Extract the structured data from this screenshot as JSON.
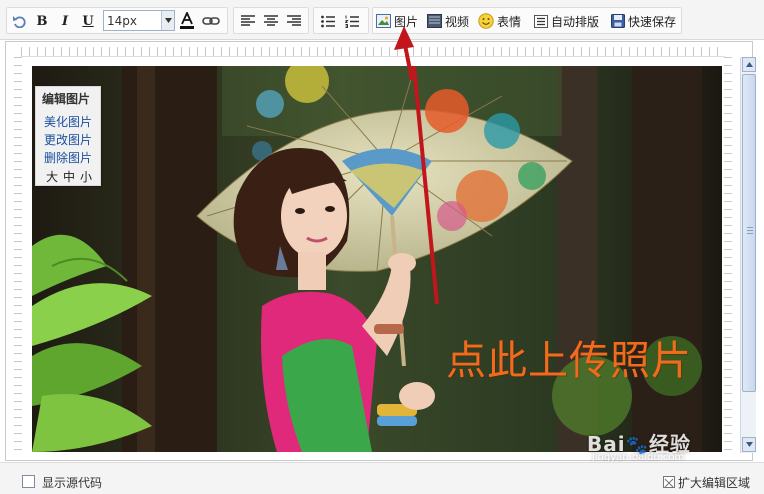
{
  "toolbar": {
    "font_size_value": "14px",
    "image_label": "图片",
    "video_label": "视频",
    "emotion_label": "表情",
    "autoformat_label": "自动排版",
    "quicksave_label": "快速保存"
  },
  "image_menu": {
    "title": "编辑图片",
    "items": [
      "美化图片",
      "更改图片",
      "删除图片"
    ],
    "sizes": [
      "大",
      "中",
      "小"
    ]
  },
  "annotation": {
    "text": "点此上传照片",
    "color": "#f26a1b"
  },
  "watermark": {
    "brand": "Bai",
    "brand_suffix": "经验",
    "url": "jingyan.baidu.com"
  },
  "footer": {
    "show_source_label": "显示源代码",
    "expand_label": "扩大编辑区域"
  },
  "colors": {
    "accent_arrow": "#c0161c",
    "link": "#1a4fa0"
  }
}
